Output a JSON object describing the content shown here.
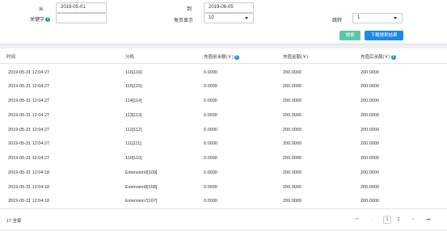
{
  "filters": {
    "from_label": "从",
    "from_value": "2019-05-01",
    "to_label": "到",
    "to_value": "2019-06-05",
    "keyword_label": "关键字",
    "keyword_value": "",
    "per_page_label": "每页显示",
    "per_page_value": "10",
    "jump_label": "跳转",
    "jump_value": "1",
    "search_button": "搜索",
    "download_button": "下载搜索结果"
  },
  "table": {
    "headers": [
      "时间",
      "分机",
      "充值前余额(￥)",
      "充值金额(￥)",
      "充值后余额(￥)"
    ],
    "rows": [
      [
        "2019-05-31 12:04:27",
        "116[116]",
        "0.0000",
        "200.0000",
        "200.0000"
      ],
      [
        "2019-05-31 12:04:27",
        "115[115]",
        "0.0000",
        "200.0000",
        "200.0000"
      ],
      [
        "2019-05-31 12:04:27",
        "114[114]",
        "0.0000",
        "200.0000",
        "200.0000"
      ],
      [
        "2019-05-31 12:04:27",
        "113[113]",
        "0.0000",
        "200.0000",
        "200.0000"
      ],
      [
        "2019-05-31 12:04:27",
        "112[112]",
        "0.0000",
        "200.0000",
        "200.0000"
      ],
      [
        "2019-05-31 12:04:27",
        "111[111]",
        "0.0000",
        "200.0000",
        "200.0000"
      ],
      [
        "2019-05-31 12:04:27",
        "110[110]",
        "0.0000",
        "200.0000",
        "200.0000"
      ],
      [
        "2019-05-31 12:04:18",
        "Extension9[109]",
        "0.0000",
        "200.0000",
        "200.0000"
      ],
      [
        "2019-05-31 12:04:18",
        "Extension8[108]",
        "0.0000",
        "200.0000",
        "200.0000"
      ],
      [
        "2019-05-31 12:04:18",
        "Extension7[107]",
        "0.0000",
        "200.0000",
        "200.0000"
      ]
    ]
  },
  "footer": {
    "total_text": "17 全部",
    "pages": [
      "1",
      "2"
    ],
    "first_icon": "⏮",
    "prev_icon": "‹",
    "next_icon": "›",
    "last_icon": "⏭"
  },
  "colors": {
    "search_button": "#5cc6a8",
    "download_button": "#1e88e5",
    "help_icon": "#1e88e5"
  }
}
